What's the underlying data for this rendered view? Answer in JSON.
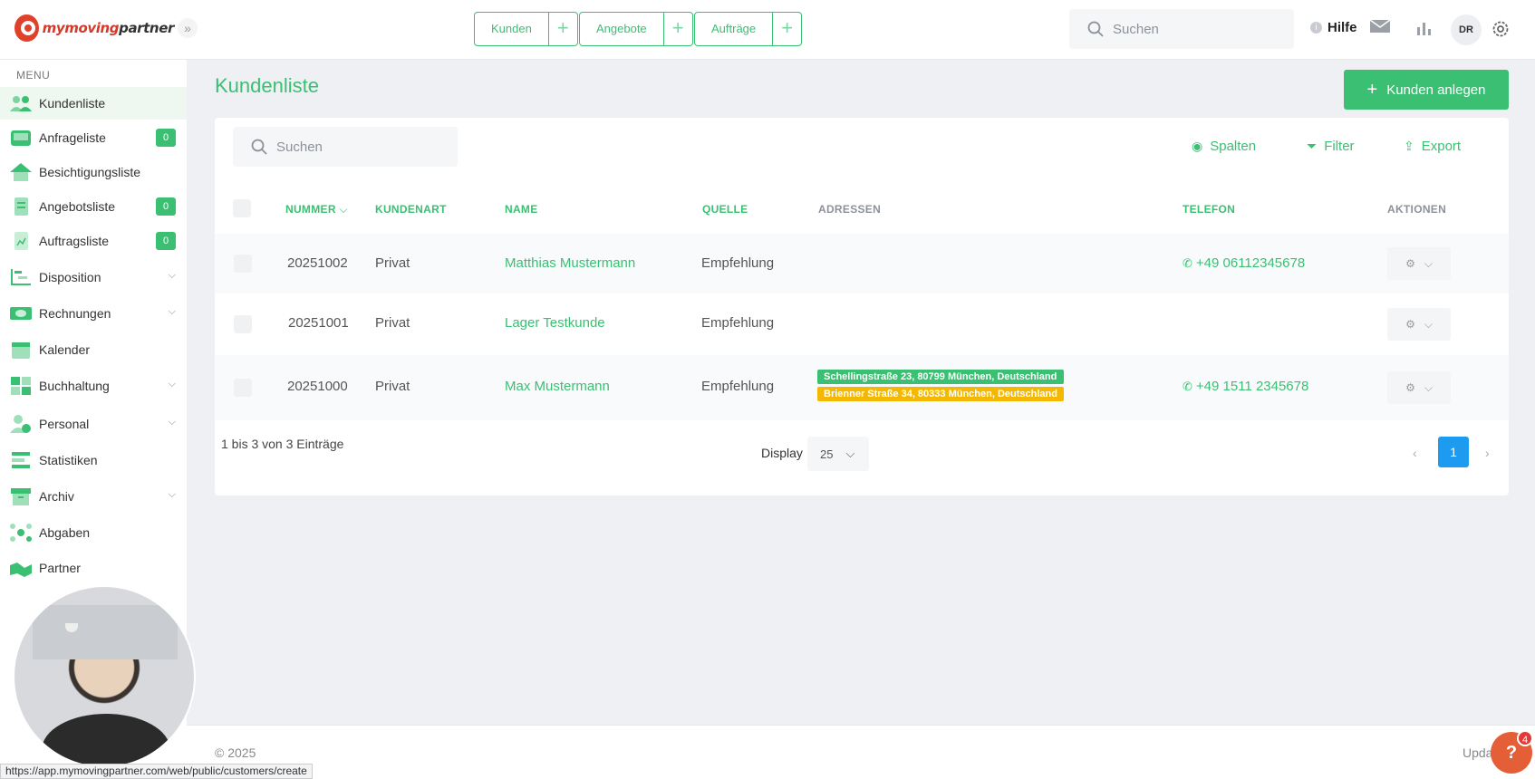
{
  "brand": {
    "name_part1": "mymoving",
    "name_part2": "partner"
  },
  "topbar": {
    "quick_actions": [
      {
        "label": "Kunden"
      },
      {
        "label": "Angebote"
      },
      {
        "label": "Aufträge"
      }
    ],
    "search_placeholder": "Suchen",
    "help_label": "Hilfe",
    "avatar_initials": "DR"
  },
  "sidebar": {
    "menu_title": "MENU",
    "items": [
      {
        "label": "Kundenliste",
        "icon": "users-icon",
        "active": true
      },
      {
        "label": "Anfrageliste",
        "icon": "inbox-icon",
        "badge": "0"
      },
      {
        "label": "Besichtigungsliste",
        "icon": "house-icon"
      },
      {
        "label": "Angebotsliste",
        "icon": "document-icon",
        "badge": "0"
      },
      {
        "label": "Auftragsliste",
        "icon": "clipboard-icon",
        "badge": "0"
      },
      {
        "label": "Disposition",
        "icon": "gantt-icon",
        "expandable": true
      },
      {
        "label": "Rechnungen",
        "icon": "money-icon",
        "expandable": true
      },
      {
        "label": "Kalender",
        "icon": "calendar-icon"
      },
      {
        "label": "Buchhaltung",
        "icon": "calculator-icon",
        "expandable": true
      },
      {
        "label": "Personal",
        "icon": "person-clock-icon",
        "expandable": true
      },
      {
        "label": "Statistiken",
        "icon": "stats-icon"
      },
      {
        "label": "Archiv",
        "icon": "archive-icon",
        "expandable": true
      },
      {
        "label": "Abgaben",
        "icon": "network-icon"
      },
      {
        "label": "Partner",
        "icon": "handshake-icon"
      }
    ]
  },
  "main": {
    "title": "Kundenliste",
    "add_button": "Kunden anlegen",
    "search_placeholder": "Suchen",
    "tools": {
      "columns": "Spalten",
      "filter": "Filter",
      "export": "Export"
    },
    "columns": {
      "number": "NUMMER",
      "type": "KUNDENART",
      "name": "NAME",
      "source": "QUELLE",
      "addresses": "ADRESSEN",
      "phone": "TELEFON",
      "actions": "AKTIONEN"
    },
    "rows": [
      {
        "number": "20251002",
        "type": "Privat",
        "name": "Matthias Mustermann",
        "source": "Empfehlung",
        "addresses": [],
        "phone": "+49 06112345678"
      },
      {
        "number": "20251001",
        "type": "Privat",
        "name": "Lager Testkunde",
        "source": "Empfehlung",
        "addresses": [],
        "phone": ""
      },
      {
        "number": "20251000",
        "type": "Privat",
        "name": "Max Mustermann",
        "source": "Empfehlung",
        "addresses": [
          {
            "text": "Schellingstraße 23, 80799 München, Deutschland",
            "color": "#3bbf73"
          },
          {
            "text": "Brienner Straße 34, 80333 München, Deutschland",
            "color": "#f5b800"
          }
        ],
        "phone": "+49 1511 2345678"
      }
    ],
    "entries_info": "1 bis 3 von 3 Einträge",
    "display_label": "Display",
    "page_size": "25",
    "current_page": "1"
  },
  "footer": {
    "copyright": "© 2025",
    "update_text": "Upda",
    "help_fab": "?",
    "help_badge": "4"
  },
  "status_url": "https://app.mymovingpartner.com/web/public/customers/create",
  "colors": {
    "accent": "#3bbf73",
    "pagination": "#1d9bf0",
    "address_primary": "#3bbf73",
    "address_secondary": "#f5b800"
  }
}
